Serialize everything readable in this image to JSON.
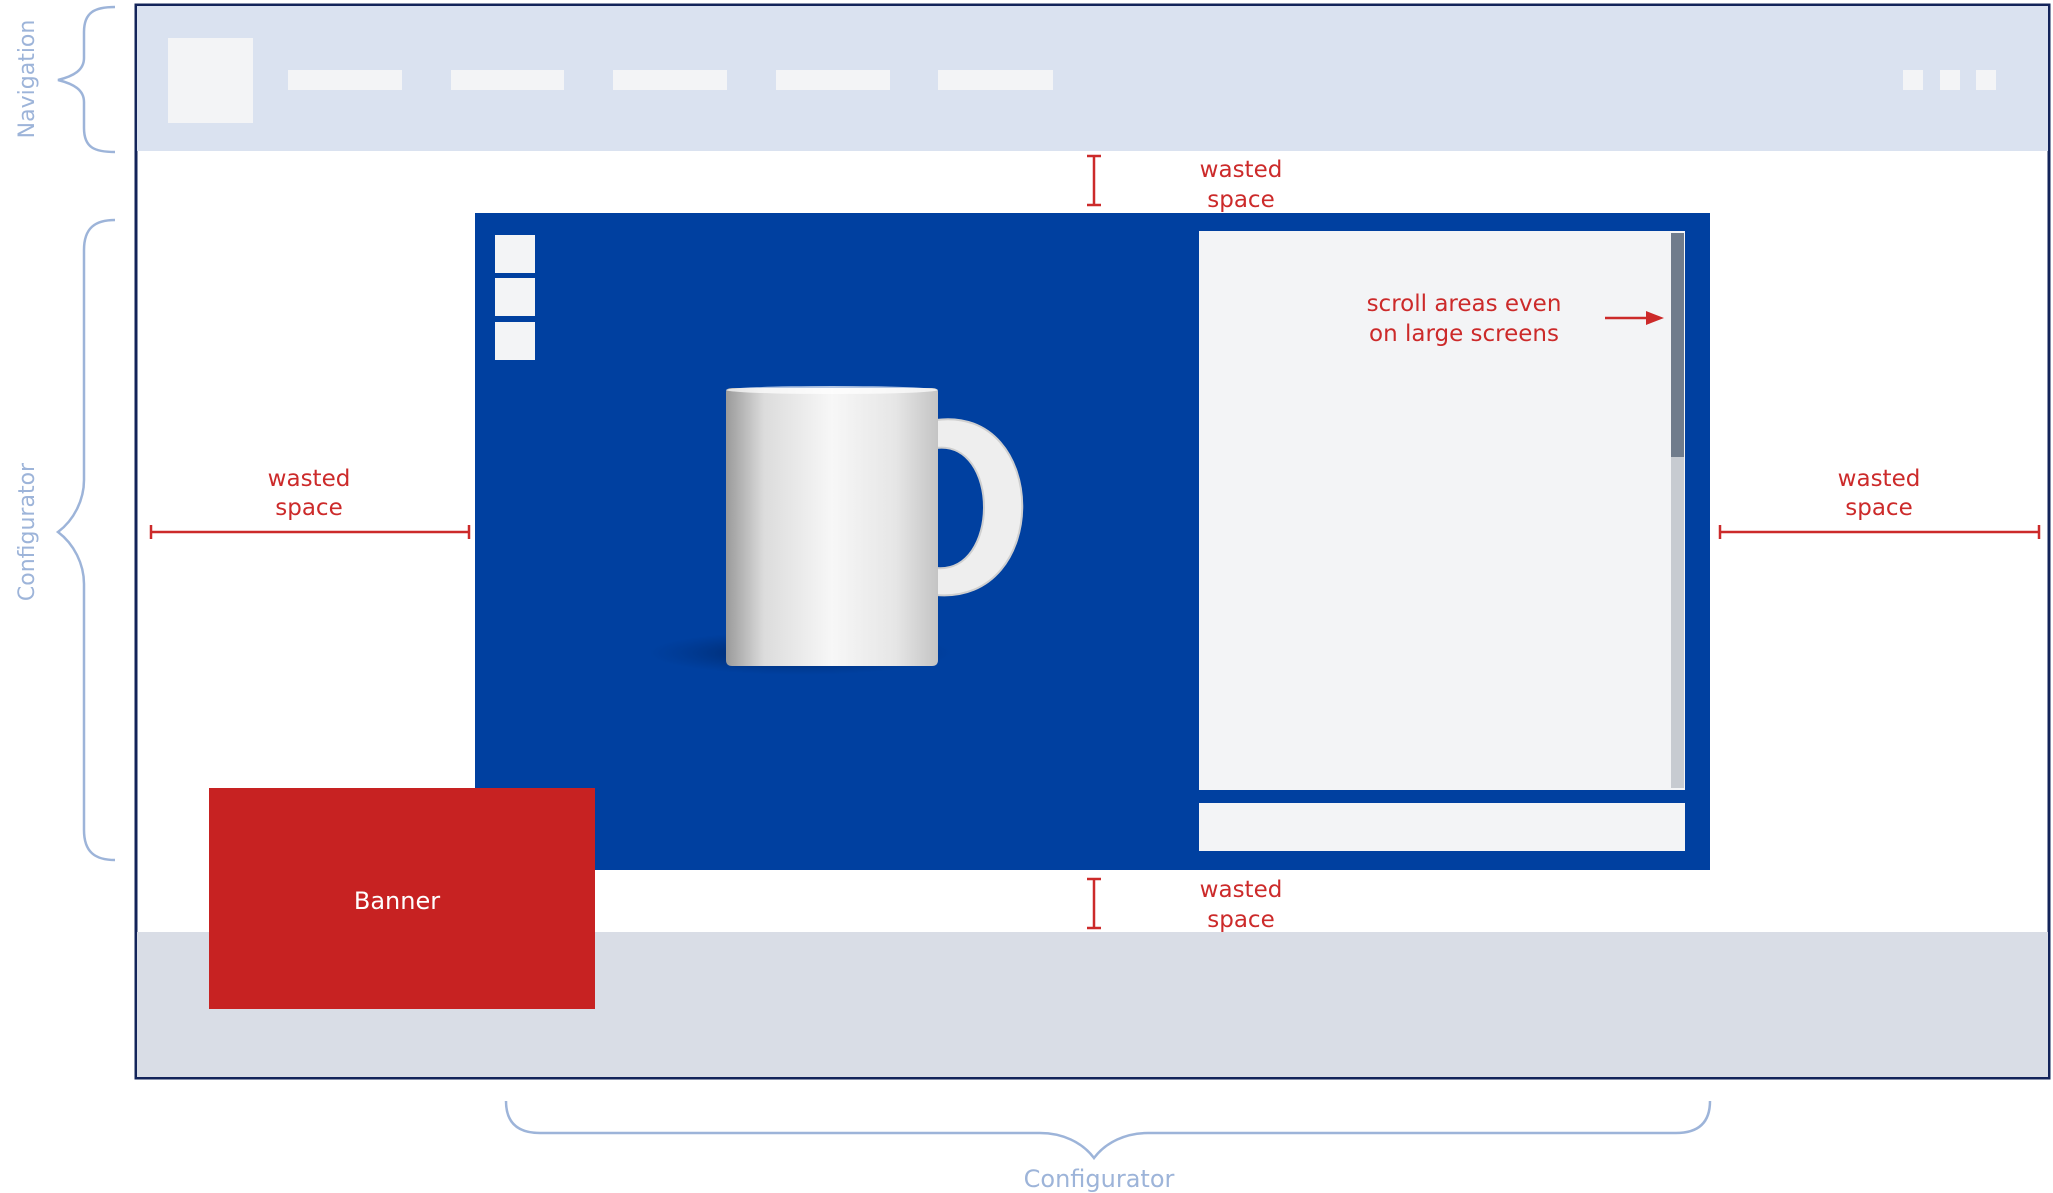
{
  "colors": {
    "nav_bg": "#dae2f0",
    "nav_placeholder": "#f3f4f6",
    "frame_border": "#13245a",
    "configurator_bg": "#0040a0",
    "panel_bg": "#f3f4f6",
    "scroll_track": "#c7cbd1",
    "scroll_thumb": "#707c8c",
    "footer_bg": "#d9dde6",
    "banner_bg": "#c72222",
    "annotation_red": "#cc2a2a",
    "bracket_blue": "#9db4d9"
  },
  "brackets": {
    "left_top_label": "Navigation",
    "left_bottom_label": "Configurator",
    "bottom_label": "Configurator"
  },
  "annotations": {
    "top_gap_line1": "wasted",
    "top_gap_line2": "space",
    "bottom_gap_line1": "wasted",
    "bottom_gap_line2": "space",
    "left_gap_line1": "wasted",
    "left_gap_line2": "space",
    "right_gap_line1": "wasted",
    "right_gap_line2": "space",
    "scroll_line1": "scroll areas even",
    "scroll_line2": "on large screens"
  },
  "banner": {
    "label": "Banner"
  },
  "icons": {
    "product": "mug-icon",
    "arrow": "arrow-right-icon"
  }
}
